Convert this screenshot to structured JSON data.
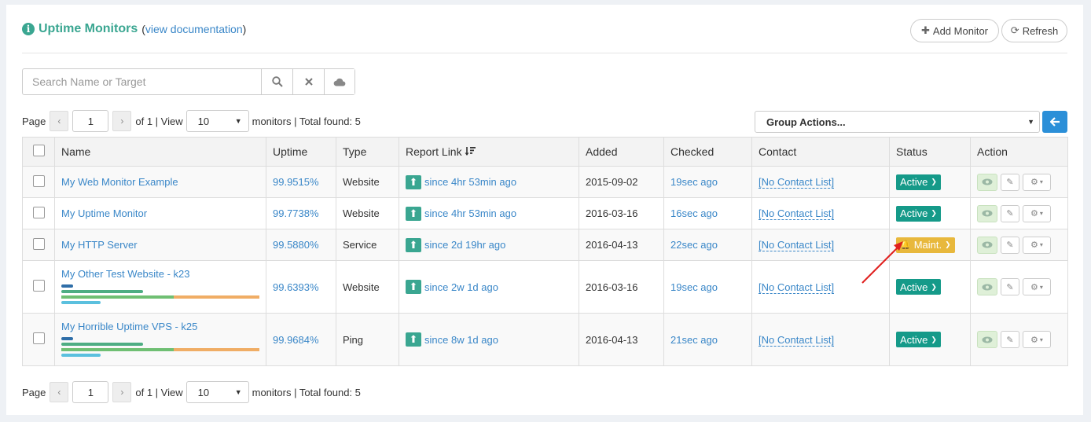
{
  "header": {
    "title": "Uptime Monitors",
    "doc_open": "(",
    "doc_link": "view documentation",
    "doc_close": ")",
    "add_label": "Add Monitor",
    "refresh_label": "Refresh"
  },
  "search": {
    "placeholder": "Search Name or Target"
  },
  "pager": {
    "page_label": "Page",
    "page": "1",
    "of_text": "of 1 | View",
    "per_page": "10",
    "total_text": "monitors | Total found: 5"
  },
  "group_actions": {
    "label": "Group Actions..."
  },
  "table": {
    "columns": [
      "Name",
      "Uptime",
      "Type",
      "Report Link",
      "Added",
      "Checked",
      "Contact",
      "Status",
      "Action"
    ],
    "rows": [
      {
        "name": "My Web Monitor Example",
        "uptime": "99.9515%",
        "type": "Website",
        "report": "since 4hr 53min ago",
        "added": "2015-09-02",
        "checked": "19sec ago",
        "contact": "[No Contact List]",
        "status": "Active"
      },
      {
        "name": "My Uptime Monitor",
        "uptime": "99.7738%",
        "type": "Website",
        "report": "since 4hr 53min ago",
        "added": "2016-03-16",
        "checked": "16sec ago",
        "contact": "[No Contact List]",
        "status": "Active"
      },
      {
        "name": "My HTTP Server",
        "uptime": "99.5880%",
        "type": "Service",
        "report": "since 2d 19hr ago",
        "added": "2016-04-13",
        "checked": "22sec ago",
        "contact": "[No Contact List]",
        "status": "Maint."
      },
      {
        "name": "My Other Test Website - k23",
        "uptime": "99.6393%",
        "type": "Website",
        "report": "since 2w 1d ago",
        "added": "2016-03-16",
        "checked": "19sec ago",
        "contact": "[No Contact List]",
        "status": "Active"
      },
      {
        "name": "My Horrible Uptime VPS - k25",
        "uptime": "99.9684%",
        "type": "Ping",
        "report": "since 8w 1d ago",
        "added": "2016-04-13",
        "checked": "21sec ago",
        "contact": "[No Contact List]",
        "status": "Active"
      }
    ]
  },
  "colors": {
    "accent": "#3aa691",
    "link": "#3a87c8",
    "active": "#159a89",
    "maint": "#e8b83c",
    "primary_button": "#2b8fd8"
  }
}
